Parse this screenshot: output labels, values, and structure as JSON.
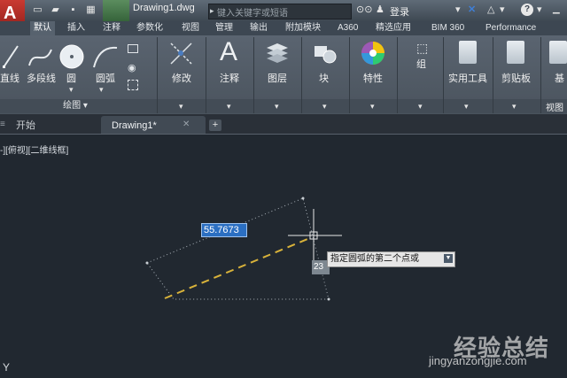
{
  "app": {
    "logo_letter": "A"
  },
  "titlebar": {
    "document_title": "Drawing1.dwg",
    "search_placeholder": "键入关键字或短语",
    "login_label": "登录",
    "help_label": "?"
  },
  "ribbon_tabs": [
    {
      "label": "默认",
      "active": true
    },
    {
      "label": "插入"
    },
    {
      "label": "注释"
    },
    {
      "label": "参数化"
    },
    {
      "label": "视图"
    },
    {
      "label": "管理"
    },
    {
      "label": "输出"
    },
    {
      "label": "附加模块"
    },
    {
      "label": "A360"
    },
    {
      "label": "精选应用"
    },
    {
      "label": "BIM 360"
    },
    {
      "label": "Performance"
    }
  ],
  "ribbon": {
    "draw_group_label": "绘图",
    "tools": {
      "line": "直线",
      "polyline": "多段线",
      "circle": "圆",
      "arc": "圆弧",
      "modify": "修改",
      "annotation": "注释",
      "layers": "图层",
      "block": "块",
      "properties": "特性",
      "group": "组",
      "utilities": "实用工具",
      "clipboard": "剪贴板",
      "base": "基",
      "view": "视图"
    }
  },
  "doc_tabs": {
    "start": "开始",
    "drawing": "Drawing1*",
    "add": "+"
  },
  "viewport": {
    "view_label": "-][俯视][二维线框]",
    "dimension_value": "55.7673",
    "secondary_value": "23",
    "prompt": "指定圆弧的第二个点或",
    "ucs_label": "Y"
  },
  "watermark": {
    "title": "经验总结",
    "url": "jingyanzongjie.com"
  },
  "colors": {
    "canvas": "#212830",
    "ribbon": "#525c67",
    "dimension_bg": "#2b6fc2",
    "dashed_line": "#d8b23a"
  }
}
